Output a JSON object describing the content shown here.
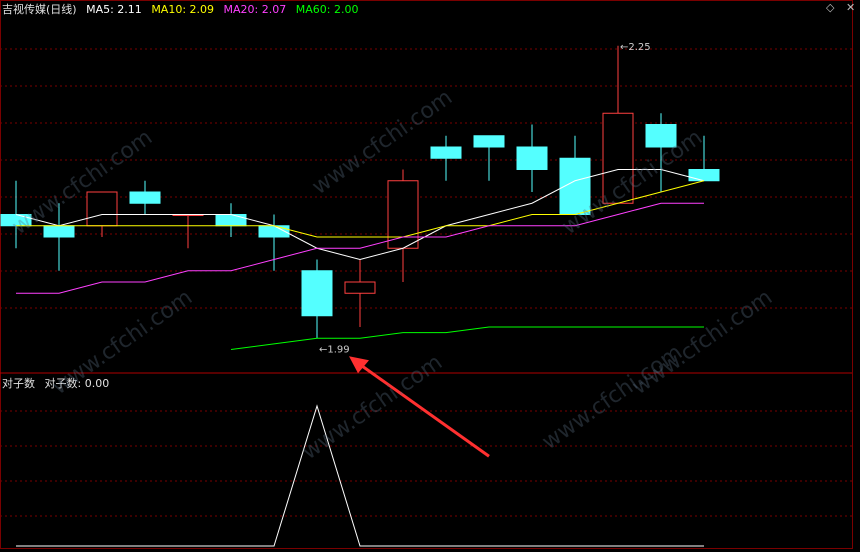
{
  "header": {
    "title": "吉视传媒(日线)",
    "indicators": [
      {
        "label": "MA5: 2.11",
        "color": "#ffffff"
      },
      {
        "label": "MA10: 2.09",
        "color": "#ffff00"
      },
      {
        "label": "MA20: 2.07",
        "color": "#ff40ff"
      },
      {
        "label": "MA60: 2.00",
        "color": "#00ff00"
      }
    ],
    "controls": [
      "◇",
      "✕"
    ]
  },
  "sub_header": {
    "title": "对子数",
    "label": "对子数: 0.00"
  },
  "watermark": "www.cfchi.com",
  "colors": {
    "up": "#ff4040",
    "down": "#54ffff",
    "grid": "#7a0000",
    "ma5": "#ffffff",
    "ma10": "#ffff00",
    "ma20": "#ff40ff",
    "ma60": "#00ff00",
    "arrow": "#ff3030",
    "indicator_line": "#ffffff"
  },
  "chart_data": [
    {
      "type": "candlestick",
      "title": "吉视传媒(日线)",
      "price_range": [
        1.96,
        2.28
      ],
      "annotations": [
        {
          "text": "2.25",
          "candle_index": 14,
          "kind": "high"
        },
        {
          "text": "1.99",
          "candle_index": 7,
          "kind": "low"
        }
      ],
      "candles": [
        {
          "open": 2.1,
          "high": 2.13,
          "low": 2.07,
          "close": 2.09
        },
        {
          "open": 2.09,
          "high": 2.11,
          "low": 2.05,
          "close": 2.08
        },
        {
          "open": 2.09,
          "high": 2.12,
          "low": 2.08,
          "close": 2.12
        },
        {
          "open": 2.12,
          "high": 2.13,
          "low": 2.1,
          "close": 2.11
        },
        {
          "open": 2.1,
          "high": 2.1,
          "low": 2.07,
          "close": 2.1
        },
        {
          "open": 2.1,
          "high": 2.11,
          "low": 2.08,
          "close": 2.09
        },
        {
          "open": 2.09,
          "high": 2.1,
          "low": 2.05,
          "close": 2.08
        },
        {
          "open": 2.05,
          "high": 2.06,
          "low": 1.99,
          "close": 2.01
        },
        {
          "open": 2.03,
          "high": 2.06,
          "low": 2.0,
          "close": 2.04
        },
        {
          "open": 2.07,
          "high": 2.14,
          "low": 2.04,
          "close": 2.13
        },
        {
          "open": 2.16,
          "high": 2.17,
          "low": 2.13,
          "close": 2.15
        },
        {
          "open": 2.17,
          "high": 2.17,
          "low": 2.13,
          "close": 2.16
        },
        {
          "open": 2.16,
          "high": 2.18,
          "low": 2.12,
          "close": 2.14
        },
        {
          "open": 2.15,
          "high": 2.17,
          "low": 2.11,
          "close": 2.1
        },
        {
          "open": 2.11,
          "high": 2.25,
          "low": 2.11,
          "close": 2.19
        },
        {
          "open": 2.18,
          "high": 2.19,
          "low": 2.12,
          "close": 2.16
        },
        {
          "open": 2.14,
          "high": 2.17,
          "low": 2.13,
          "close": 2.13
        }
      ],
      "ma": [
        {
          "name": "MA5",
          "color": "#ffffff",
          "values": [
            2.1,
            2.09,
            2.1,
            2.1,
            2.1,
            2.1,
            2.09,
            2.07,
            2.06,
            2.07,
            2.09,
            2.1,
            2.11,
            2.13,
            2.14,
            2.14,
            2.13
          ]
        },
        {
          "name": "MA10",
          "color": "#ffff00",
          "values": [
            2.09,
            2.09,
            2.09,
            2.09,
            2.09,
            2.09,
            2.09,
            2.08,
            2.08,
            2.08,
            2.09,
            2.09,
            2.1,
            2.1,
            2.11,
            2.12,
            2.13
          ]
        },
        {
          "name": "MA20",
          "color": "#ff40ff",
          "values": [
            2.03,
            2.03,
            2.04,
            2.04,
            2.05,
            2.05,
            2.06,
            2.07,
            2.07,
            2.08,
            2.08,
            2.09,
            2.09,
            2.09,
            2.1,
            2.11,
            2.11
          ]
        },
        {
          "name": "MA60",
          "color": "#00ff00",
          "values": [
            null,
            null,
            null,
            null,
            null,
            1.98,
            1.985,
            1.99,
            1.99,
            1.995,
            1.995,
            2.0,
            2.0,
            2.0,
            2.0,
            2.0,
            2.0
          ]
        }
      ]
    },
    {
      "type": "line",
      "title": "对子数",
      "series": [
        {
          "values": [
            0,
            0,
            0,
            0,
            0,
            0,
            0,
            1,
            0,
            0,
            0,
            0,
            0,
            0,
            0,
            0,
            0
          ]
        }
      ],
      "ylim": [
        0,
        1.2
      ]
    }
  ]
}
